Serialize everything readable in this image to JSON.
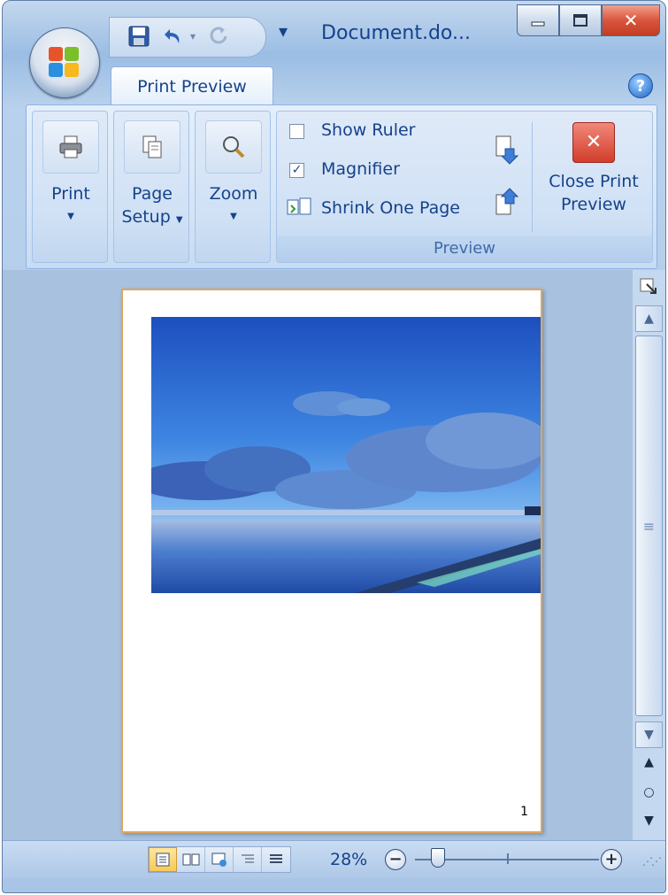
{
  "window": {
    "title": "Document.do...",
    "qat_menu_glyph": "▾"
  },
  "tabs": [
    {
      "label": "Print Preview"
    }
  ],
  "ribbon": {
    "print": {
      "label": "Print"
    },
    "page_setup": {
      "line1": "Page",
      "line2": "Setup"
    },
    "zoom": {
      "label": "Zoom"
    },
    "preview": {
      "show_ruler": {
        "label": "Show Ruler",
        "checked": false
      },
      "magnifier": {
        "label": "Magnifier",
        "checked": true
      },
      "shrink": {
        "label": "Shrink One Page"
      },
      "group_label": "Preview"
    },
    "close": {
      "line1": "Close Print",
      "line2": "Preview"
    }
  },
  "document": {
    "page_number": "1"
  },
  "statusbar": {
    "zoom_percent": "28%",
    "zoom_level": 0.28
  }
}
